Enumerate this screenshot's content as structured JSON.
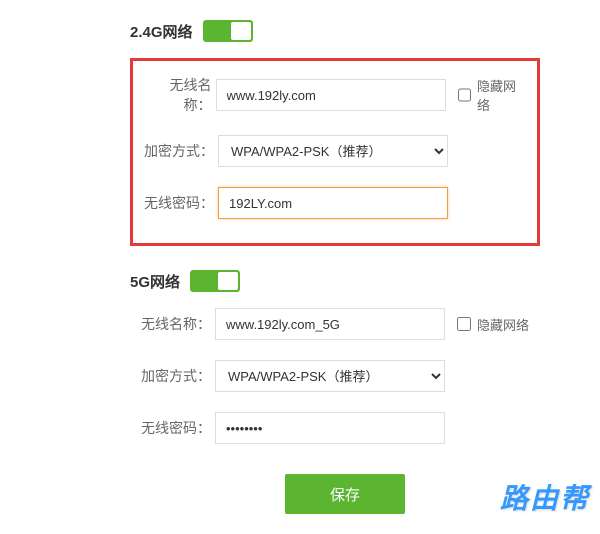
{
  "section24": {
    "title": "2.4G网络",
    "toggle": true,
    "ssid_label": "无线名称：",
    "ssid_value": "www.192ly.com",
    "hide_label": "隐藏网络",
    "encryption_label": "加密方式：",
    "encryption_value": "WPA/WPA2-PSK（推荐）",
    "password_label": "无线密码：",
    "password_value": "192LY.com"
  },
  "section5g": {
    "title": "5G网络",
    "toggle": true,
    "ssid_label": "无线名称：",
    "ssid_value": "www.192ly.com_5G",
    "hide_label": "隐藏网络",
    "encryption_label": "加密方式：",
    "encryption_value": "WPA/WPA2-PSK（推荐）",
    "password_label": "无线密码：",
    "password_value": "••••••••"
  },
  "save_label": "保存",
  "watermark": "路由帮"
}
